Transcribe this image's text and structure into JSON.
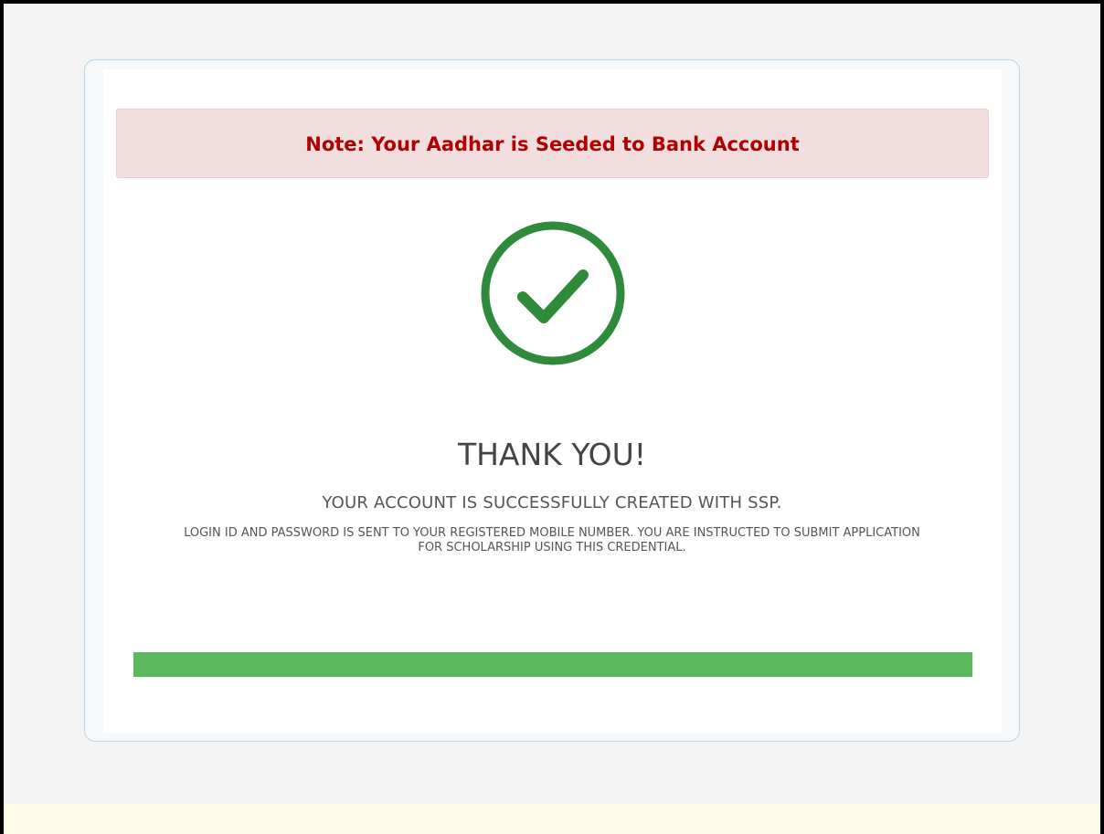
{
  "note": {
    "text": "Note: Your Aadhar is Seeded to Bank Account"
  },
  "success": {
    "icon": "check-circle-icon",
    "title": "THANK YOU!",
    "message": "YOUR ACCOUNT IS SUCCESSFULLY CREATED WITH SSP.",
    "instructions": "LOGIN ID AND PASSWORD IS SENT TO YOUR REGISTERED MOBILE NUMBER. YOU ARE INSTRUCTED TO SUBMIT APPLICATION FOR SCHOLARSHIP USING THIS CREDENTIAL."
  },
  "progress": {
    "percent": 100
  },
  "colors": {
    "note_background": "#f2dede",
    "note_text": "#b00000",
    "check_green": "#2e8b3a",
    "progress_green": "#5cb85c",
    "card_border": "#b9d6ea"
  }
}
